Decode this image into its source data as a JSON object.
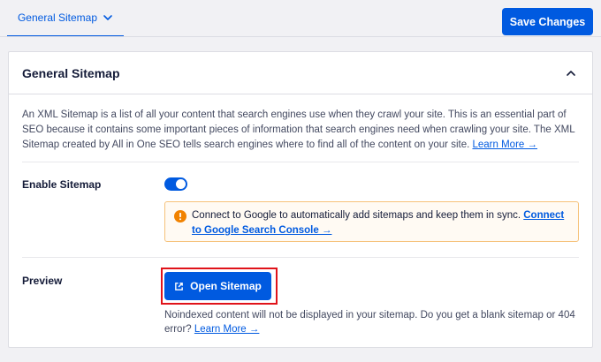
{
  "tabs": {
    "active_label": "General Sitemap"
  },
  "toolbar": {
    "save_label": "Save Changes"
  },
  "card": {
    "title": "General Sitemap",
    "description": "An XML Sitemap is a list of all your content that search engines use when they crawl your site. This is an essential part of SEO because it contains some important pieces of information that search engines need when crawling your site. The XML Sitemap created by All in One SEO tells search engines where to find all of the content on your site.",
    "description_link": "Learn More →"
  },
  "enable_sitemap": {
    "label": "Enable Sitemap",
    "enabled": true
  },
  "alert": {
    "text": "Connect to Google to automatically add sitemaps and keep them in sync.",
    "link": "Connect to Google Search Console →"
  },
  "preview": {
    "label": "Preview",
    "button_label": "Open Sitemap",
    "note": "Noindexed content will not be displayed in your sitemap. Do you get a blank sitemap or 404 error?",
    "note_link": "Learn More →"
  },
  "colors": {
    "accent": "#005ae0",
    "warning": "#f18200",
    "highlight": "#e0131a"
  }
}
